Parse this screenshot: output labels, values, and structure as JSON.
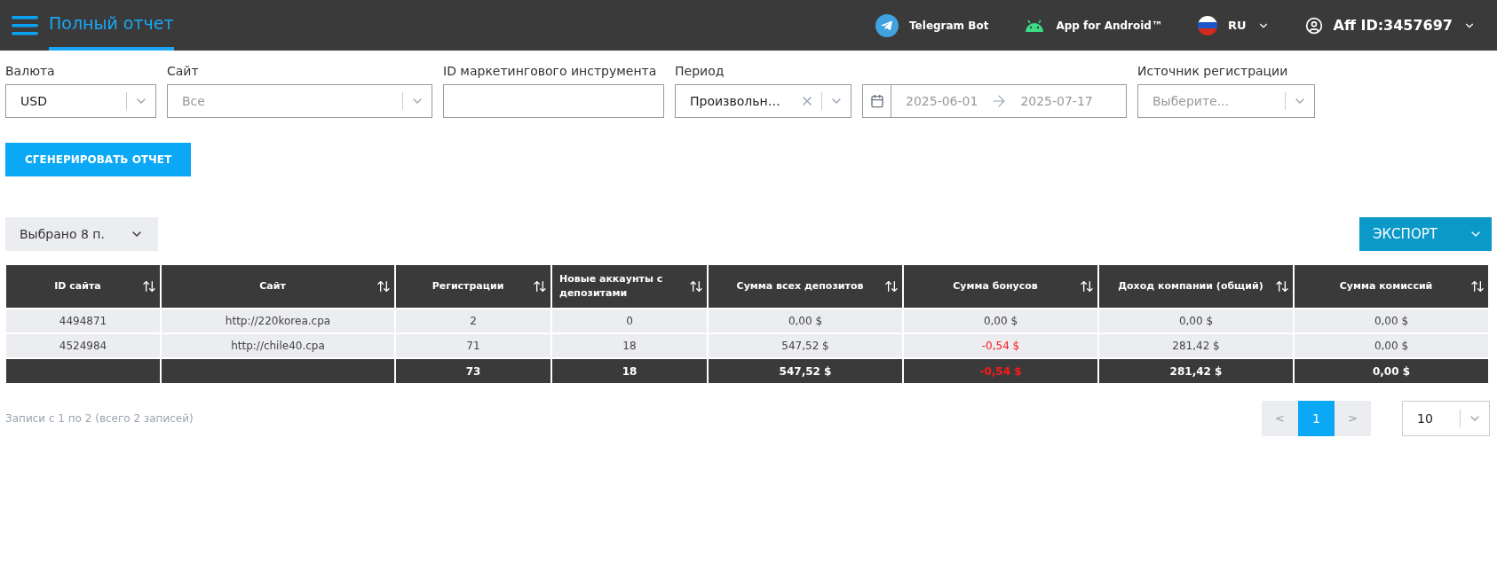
{
  "header": {
    "title": "Полный отчет",
    "title_selected": true,
    "links": [
      {
        "kind": "telegram",
        "label": "Telegram Bot"
      },
      {
        "kind": "android",
        "label": "App for Android™"
      },
      {
        "kind": "language",
        "label": "RU"
      },
      {
        "kind": "account",
        "label": "Aff ID:3457697"
      }
    ]
  },
  "filters": [
    {
      "kind": "select",
      "label": "Валюта",
      "value": "USD"
    },
    {
      "kind": "select",
      "label": "Сайт",
      "placeholder": "Все"
    },
    {
      "kind": "input",
      "label": "ID маркетингового инструмента"
    },
    {
      "kind": "select",
      "label": "Период",
      "value": "Произвольн…",
      "clearable": true
    },
    {
      "kind": "daterange",
      "from": "2025-06-01",
      "to": "2025-07-17"
    },
    {
      "kind": "select",
      "label": "Источник регистрации",
      "placeholder": "Выберите..."
    }
  ],
  "generate_button": "СГЕНЕРИРОВАТЬ ОТЧЕТ",
  "columns_selector": "Выбрано 8 п.",
  "export_button": "ЭКСПОРТ",
  "table": {
    "columns": [
      "ID сайта",
      "Сайт",
      "Регистрации",
      "Новые аккаунты с депозитами",
      "Сумма всех депозитов",
      "Сумма бонусов",
      "Доход компании (общий)",
      "Сумма комиссий"
    ],
    "rows": [
      {
        "total": false,
        "cells": [
          {
            "value": "4494871",
            "negative": false
          },
          {
            "value": "http://220korea.cpa",
            "negative": false
          },
          {
            "value": "2",
            "negative": false
          },
          {
            "value": "0",
            "negative": false
          },
          {
            "value": "0,00 $",
            "negative": false
          },
          {
            "value": "0,00 $",
            "negative": false
          },
          {
            "value": "0,00 $",
            "negative": false
          },
          {
            "value": "0,00 $",
            "negative": false
          }
        ]
      },
      {
        "total": false,
        "cells": [
          {
            "value": "4524984",
            "negative": false
          },
          {
            "value": "http://chile40.cpa",
            "negative": false
          },
          {
            "value": "71",
            "negative": false
          },
          {
            "value": "18",
            "negative": false
          },
          {
            "value": "547,52 $",
            "negative": false
          },
          {
            "value": "-0,54 $",
            "negative": true
          },
          {
            "value": "281,42 $",
            "negative": false
          },
          {
            "value": "0,00 $",
            "negative": false
          }
        ]
      },
      {
        "total": true,
        "cells": [
          null,
          null,
          {
            "value": "73",
            "negative": false
          },
          {
            "value": "18",
            "negative": false
          },
          {
            "value": "547,52 $",
            "negative": false
          },
          {
            "value": "-0,54 $",
            "negative": true
          },
          {
            "value": "281,42 $",
            "negative": false
          },
          {
            "value": "0,00 $",
            "negative": false
          }
        ]
      }
    ]
  },
  "footer": {
    "info": "Записи с 1 по 2 (всего 2 записей)",
    "prev": "<",
    "pages": [
      {
        "label": "1",
        "selected": true
      }
    ],
    "next": ">",
    "page_size": "10"
  }
}
